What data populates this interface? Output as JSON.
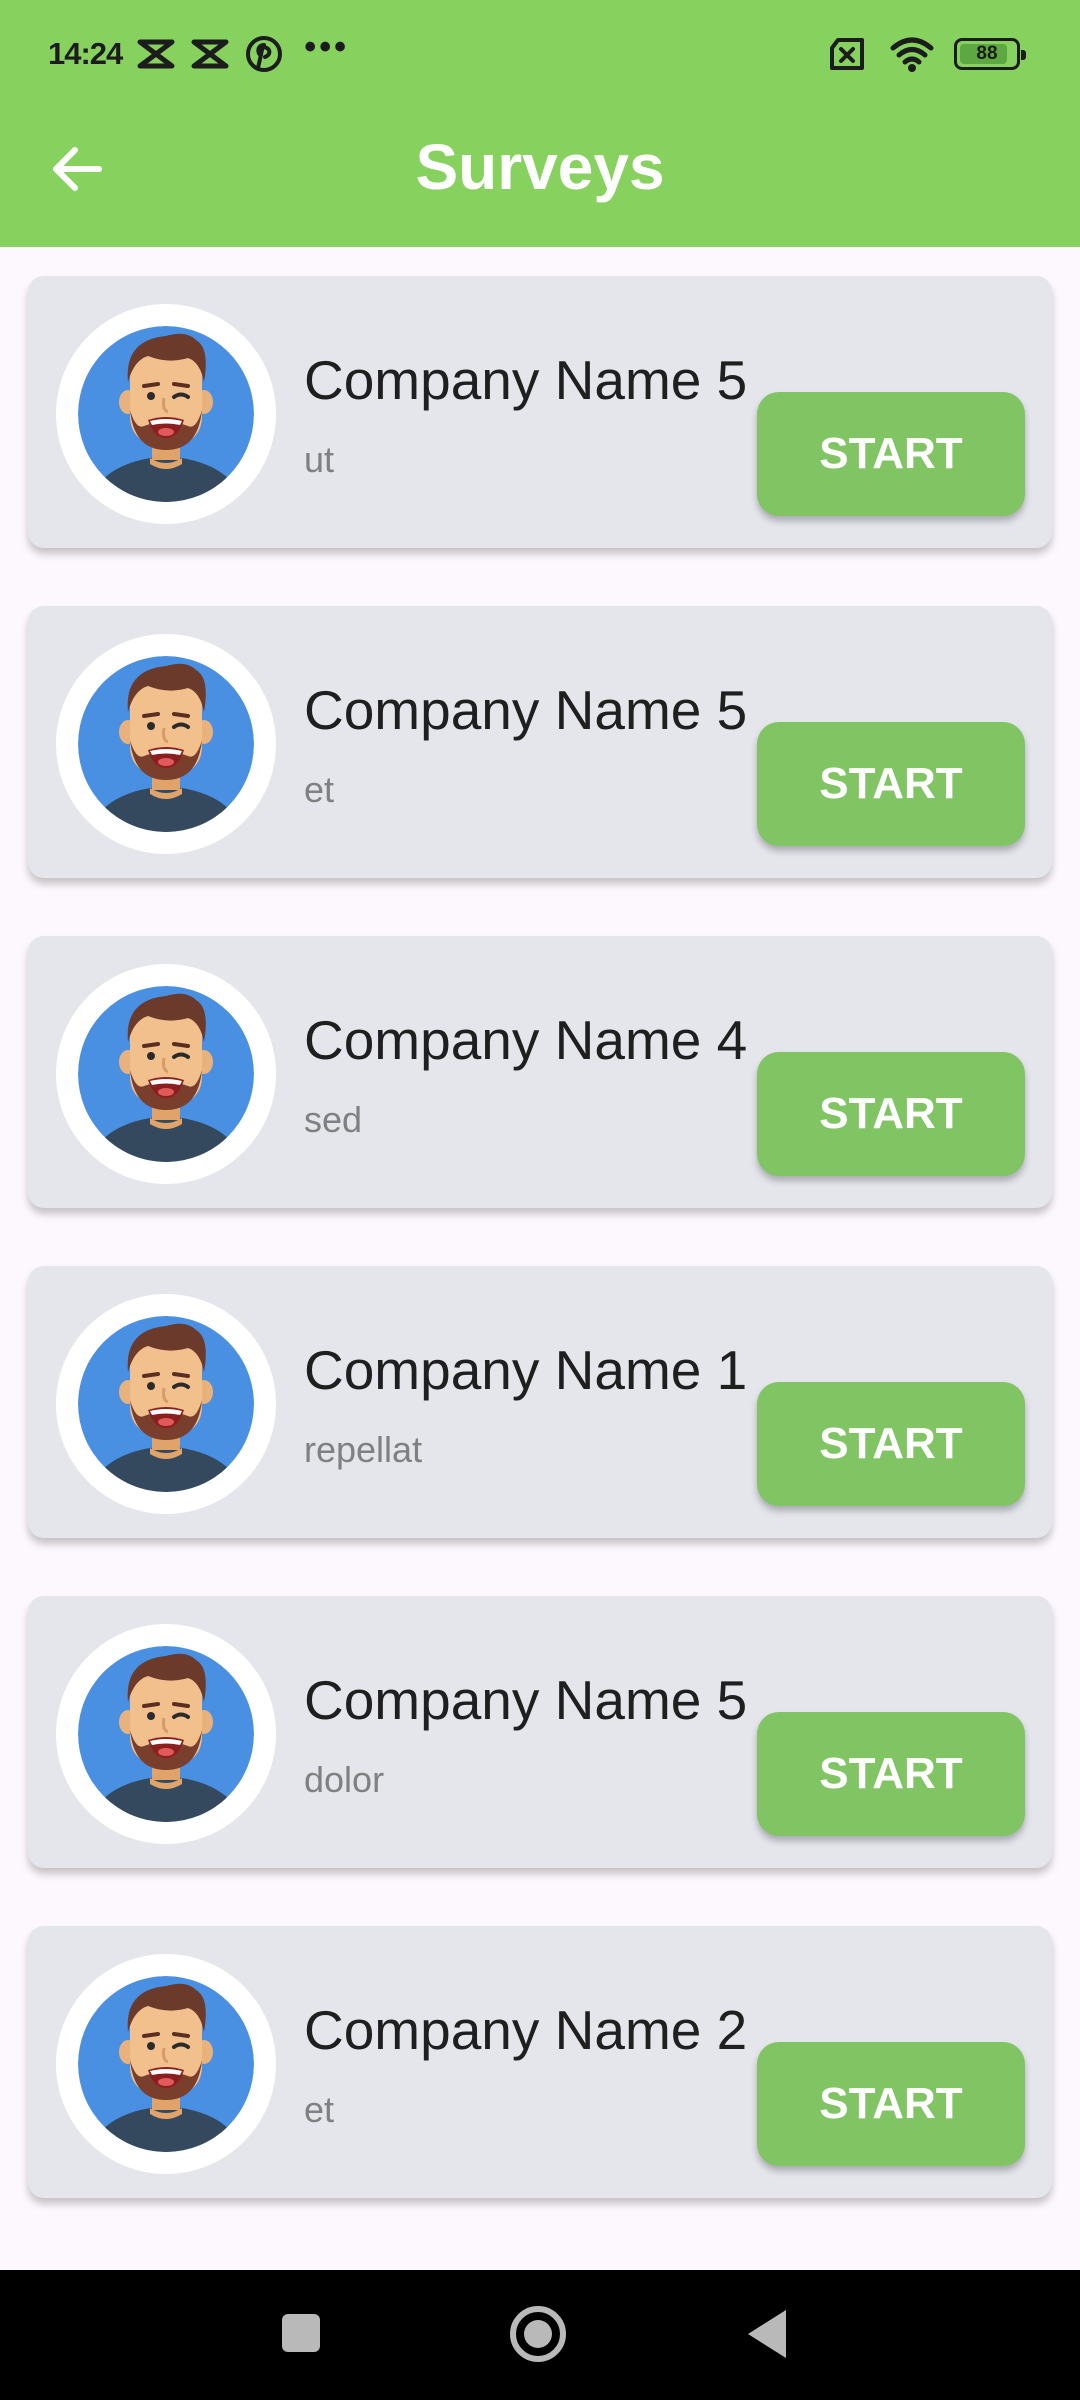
{
  "status_bar": {
    "time": "14:24",
    "battery": "88",
    "icons": [
      "capcut-icon",
      "capcut-icon",
      "pinterest-icon",
      "more-dots-icon",
      "sim-off-icon",
      "wifi-icon",
      "battery-icon"
    ]
  },
  "header": {
    "title": "Surveys",
    "back_icon": "arrow-left-icon",
    "background_color": "#87d15f"
  },
  "surveys": [
    {
      "company": "Company Name 5",
      "subtitle": "ut",
      "button": "START"
    },
    {
      "company": "Company Name 5",
      "subtitle": "et",
      "button": "START"
    },
    {
      "company": "Company Name 4",
      "subtitle": "sed",
      "button": "START"
    },
    {
      "company": "Company Name 1",
      "subtitle": "repellat",
      "button": "START"
    },
    {
      "company": "Company Name 5",
      "subtitle": "dolor",
      "button": "START"
    },
    {
      "company": "Company Name 2",
      "subtitle": "et",
      "button": "START"
    }
  ],
  "colors": {
    "accent": "#87d15f",
    "button": "#80c464",
    "card": "#e4e6ec"
  },
  "nav_bar": {
    "icons": [
      "recent-apps-icon",
      "home-icon",
      "back-triangle-icon"
    ]
  }
}
